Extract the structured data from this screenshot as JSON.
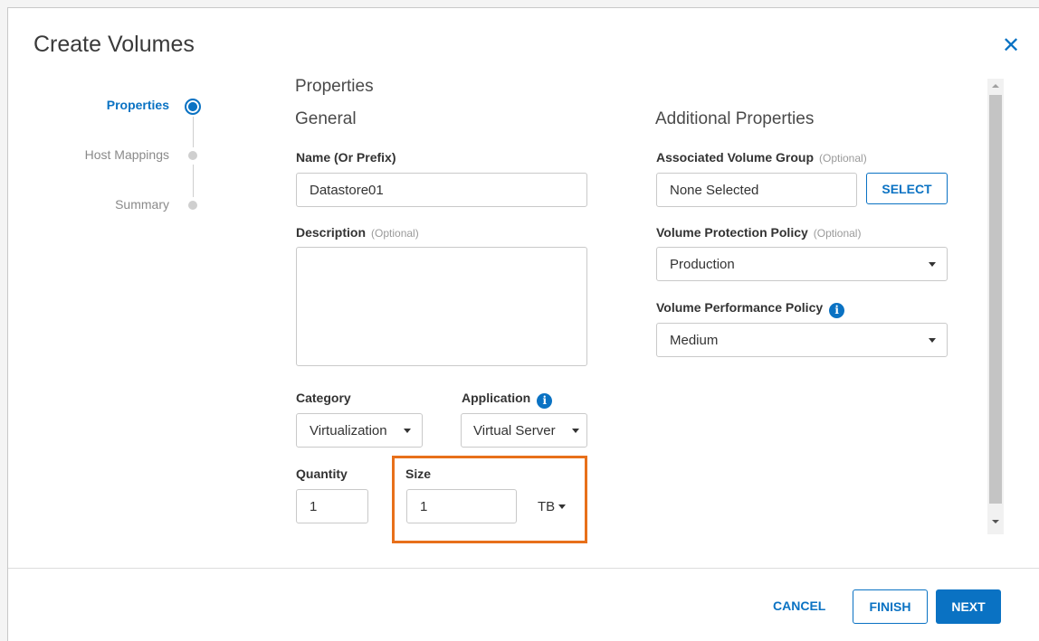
{
  "dialog": {
    "title": "Create Volumes",
    "close_icon": "close-icon"
  },
  "stepper": {
    "steps": [
      {
        "label": "Properties",
        "state": "active"
      },
      {
        "label": "Host Mappings",
        "state": "pending"
      },
      {
        "label": "Summary",
        "state": "pending"
      }
    ]
  },
  "main": {
    "section_title": "Properties",
    "general_title": "General",
    "additional_title": "Additional Properties",
    "name": {
      "label": "Name (Or Prefix)",
      "value": "Datastore01"
    },
    "description": {
      "label": "Description",
      "optional": "(Optional)",
      "value": ""
    },
    "category": {
      "label": "Category",
      "value": "Virtualization"
    },
    "application": {
      "label": "Application",
      "value": "Virtual Server"
    },
    "quantity": {
      "label": "Quantity",
      "value": "1"
    },
    "size": {
      "label": "Size",
      "value": "1",
      "unit": "TB"
    },
    "volume_group": {
      "label": "Associated Volume Group",
      "optional": "(Optional)",
      "value": "None Selected",
      "button": "SELECT"
    },
    "protection": {
      "label": "Volume Protection Policy",
      "optional": "(Optional)",
      "value": "Production"
    },
    "performance": {
      "label": "Volume Performance Policy",
      "value": "Medium"
    }
  },
  "footer": {
    "cancel": "CANCEL",
    "finish": "FINISH",
    "next": "NEXT"
  },
  "colors": {
    "accent": "#0a72c3",
    "highlight": "#e8701a"
  }
}
